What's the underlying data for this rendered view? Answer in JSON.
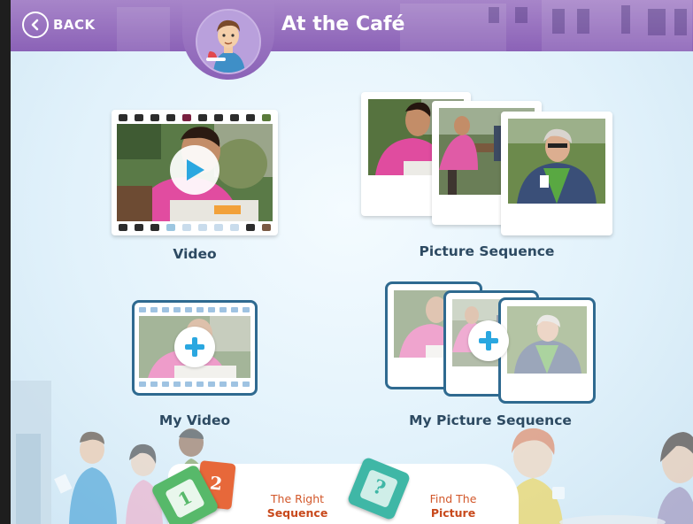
{
  "header": {
    "back_label": "BACK",
    "title": "At the Café"
  },
  "options": {
    "video": "Video",
    "picture_sequence": "Picture Sequence",
    "my_video": "My Video",
    "my_picture_sequence": "My Picture Sequence"
  },
  "games": {
    "right_sequence": {
      "line1": "The Right",
      "line2": "Sequence",
      "badge1": "1",
      "badge2": "2"
    },
    "find_picture": {
      "line1": "Find The",
      "line2": "Picture",
      "badge": "?"
    }
  },
  "colors": {
    "header_purple": "#8b62b7",
    "label_navy": "#2d4a62",
    "accent_blue": "#2aa7e0",
    "frame_blue": "#2f6a90",
    "game_orange": "#d2572a"
  }
}
